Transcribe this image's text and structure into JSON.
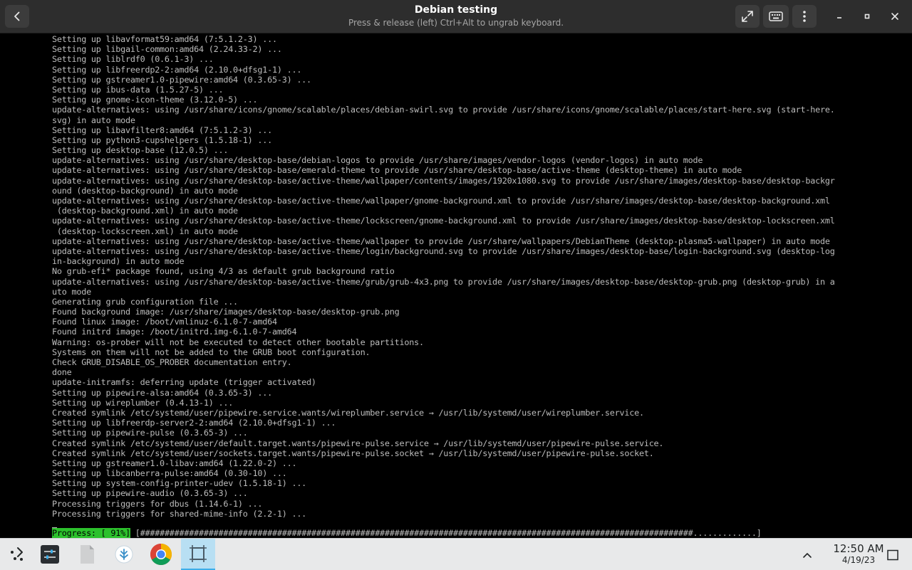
{
  "window": {
    "title": "Debian testing",
    "subtitle": "Press & release (left) Ctrl+Alt to ungrab keyboard."
  },
  "icons": {
    "back": "back-arrow-icon",
    "fullscreen": "fullscreen-icon",
    "keyboard": "keyboard-icon",
    "menu": "kebab-menu-icon",
    "minimize": "minimize-icon",
    "maximize": "maximize-icon",
    "close": "close-icon"
  },
  "terminal": {
    "lines": [
      "Setting up libavformat59:amd64 (7:5.1.2-3) ...",
      "Setting up libgail-common:amd64 (2.24.33-2) ...",
      "Setting up liblrdf0 (0.6.1-3) ...",
      "Setting up libfreerdp2-2:amd64 (2.10.0+dfsg1-1) ...",
      "Setting up gstreamer1.0-pipewire:amd64 (0.3.65-3) ...",
      "Setting up ibus-data (1.5.27-5) ...",
      "Setting up gnome-icon-theme (3.12.0-5) ...",
      "update-alternatives: using /usr/share/icons/gnome/scalable/places/debian-swirl.svg to provide /usr/share/icons/gnome/scalable/places/start-here.svg (start-here.",
      "svg) in auto mode",
      "Setting up libavfilter8:amd64 (7:5.1.2-3) ...",
      "Setting up python3-cupshelpers (1.5.18-1) ...",
      "Setting up desktop-base (12.0.5) ...",
      "update-alternatives: using /usr/share/desktop-base/debian-logos to provide /usr/share/images/vendor-logos (vendor-logos) in auto mode",
      "update-alternatives: using /usr/share/desktop-base/emerald-theme to provide /usr/share/desktop-base/active-theme (desktop-theme) in auto mode",
      "update-alternatives: using /usr/share/desktop-base/active-theme/wallpaper/contents/images/1920x1080.svg to provide /usr/share/images/desktop-base/desktop-backgr",
      "ound (desktop-background) in auto mode",
      "update-alternatives: using /usr/share/desktop-base/active-theme/wallpaper/gnome-background.xml to provide /usr/share/images/desktop-base/desktop-background.xml",
      " (desktop-background.xml) in auto mode",
      "update-alternatives: using /usr/share/desktop-base/active-theme/lockscreen/gnome-background.xml to provide /usr/share/images/desktop-base/desktop-lockscreen.xml",
      " (desktop-lockscreen.xml) in auto mode",
      "update-alternatives: using /usr/share/desktop-base/active-theme/wallpaper to provide /usr/share/wallpapers/DebianTheme (desktop-plasma5-wallpaper) in auto mode",
      "update-alternatives: using /usr/share/desktop-base/active-theme/login/background.svg to provide /usr/share/images/desktop-base/login-background.svg (desktop-log",
      "in-background) in auto mode",
      "No grub-efi* package found, using 4/3 as default grub background ratio",
      "update-alternatives: using /usr/share/desktop-base/active-theme/grub/grub-4x3.png to provide /usr/share/images/desktop-base/desktop-grub.png (desktop-grub) in a",
      "uto mode",
      "Generating grub configuration file ...",
      "Found background image: /usr/share/images/desktop-base/desktop-grub.png",
      "Found linux image: /boot/vmlinuz-6.1.0-7-amd64",
      "Found initrd image: /boot/initrd.img-6.1.0-7-amd64",
      "Warning: os-prober will not be executed to detect other bootable partitions.",
      "Systems on them will not be added to the GRUB boot configuration.",
      "Check GRUB_DISABLE_OS_PROBER documentation entry.",
      "done",
      "update-initramfs: deferring update (trigger activated)",
      "Setting up pipewire-alsa:amd64 (0.3.65-3) ...",
      "Setting up wireplumber (0.4.13-1) ...",
      "Created symlink /etc/systemd/user/pipewire.service.wants/wireplumber.service → /usr/lib/systemd/user/wireplumber.service.",
      "Setting up libfreerdp-server2-2:amd64 (2.10.0+dfsg1-1) ...",
      "Setting up pipewire-pulse (0.3.65-3) ...",
      "Created symlink /etc/systemd/user/default.target.wants/pipewire-pulse.service → /usr/lib/systemd/user/pipewire-pulse.service.",
      "Created symlink /etc/systemd/user/sockets.target.wants/pipewire-pulse.socket → /usr/lib/systemd/user/pipewire-pulse.socket.",
      "Setting up gstreamer1.0-libav:amd64 (1.22.0-2) ...",
      "Setting up libcanberra-pulse:amd64 (0.30-10) ...",
      "Setting up system-config-printer-udev (1.5.18-1) ...",
      "Setting up pipewire-audio (0.3.65-3) ...",
      "Processing triggers for dbus (1.14.6-1) ...",
      "Processing triggers for shared-mime-info (2.2-1) ..."
    ],
    "progress": {
      "label": "Progress: [ 91%]",
      "bar": " [#################################################################################################################.............]",
      "percent": 91
    }
  },
  "taskbar": {
    "apps": [
      {
        "name": "app-launcher",
        "icon": "app-launcher-icon"
      },
      {
        "name": "system-settings",
        "icon": "settings-sliders-icon"
      },
      {
        "name": "files",
        "icon": "file-icon"
      },
      {
        "name": "discover",
        "icon": "discover-icon"
      },
      {
        "name": "chrome",
        "icon": "chrome-icon"
      },
      {
        "name": "remote-desktop",
        "icon": "remote-desktop-icon"
      }
    ],
    "tray_toggle_icon": "chevron-up-icon",
    "show_desktop_icon": "show-desktop-icon",
    "clock": {
      "time": "12:50 AM",
      "date": "4/19/23"
    }
  }
}
